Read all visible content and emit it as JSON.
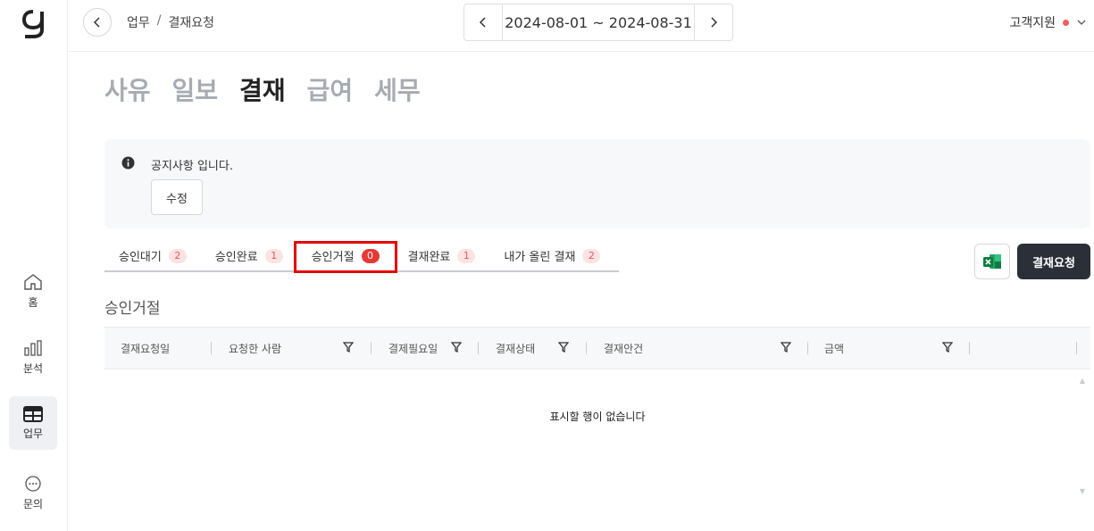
{
  "sidebar": {
    "logo": "g",
    "items": [
      {
        "label": "홈",
        "icon": "home-icon"
      },
      {
        "label": "분석",
        "icon": "chart-icon"
      },
      {
        "label": "업무",
        "icon": "table-icon",
        "active": true
      },
      {
        "label": "문의",
        "icon": "chat-icon"
      }
    ]
  },
  "topbar": {
    "breadcrumb": [
      "업무",
      "/",
      "결재요청"
    ],
    "date_range": "2024-08-01 ~ 2024-08-31",
    "support_label": "고객지원"
  },
  "categories": [
    "사유",
    "일보",
    "결재",
    "급여",
    "세무"
  ],
  "active_category": "결재",
  "notice": {
    "text": "공지사항 입니다.",
    "edit_label": "수정"
  },
  "status_tabs": [
    {
      "label": "승인대기",
      "count": "2"
    },
    {
      "label": "승인완료",
      "count": "1"
    },
    {
      "label": "승인거절",
      "count": "0"
    },
    {
      "label": "결재완료",
      "count": "1"
    },
    {
      "label": "내가 올린 결재",
      "count": "2"
    }
  ],
  "actions": {
    "request_label": "결재요청",
    "excel_icon": "excel-icon"
  },
  "section_title": "승인거절",
  "grid": {
    "columns": [
      "결재요청일",
      "요청한 사람",
      "결제필요일",
      "결재상태",
      "결재안건",
      "금액"
    ],
    "empty_text": "표시할 행이 없습니다"
  },
  "colors": {
    "primary_button": "#2b2f38",
    "badge_bg": "#fde3e3",
    "badge_active": "#e53935",
    "highlight": "#e60000"
  }
}
